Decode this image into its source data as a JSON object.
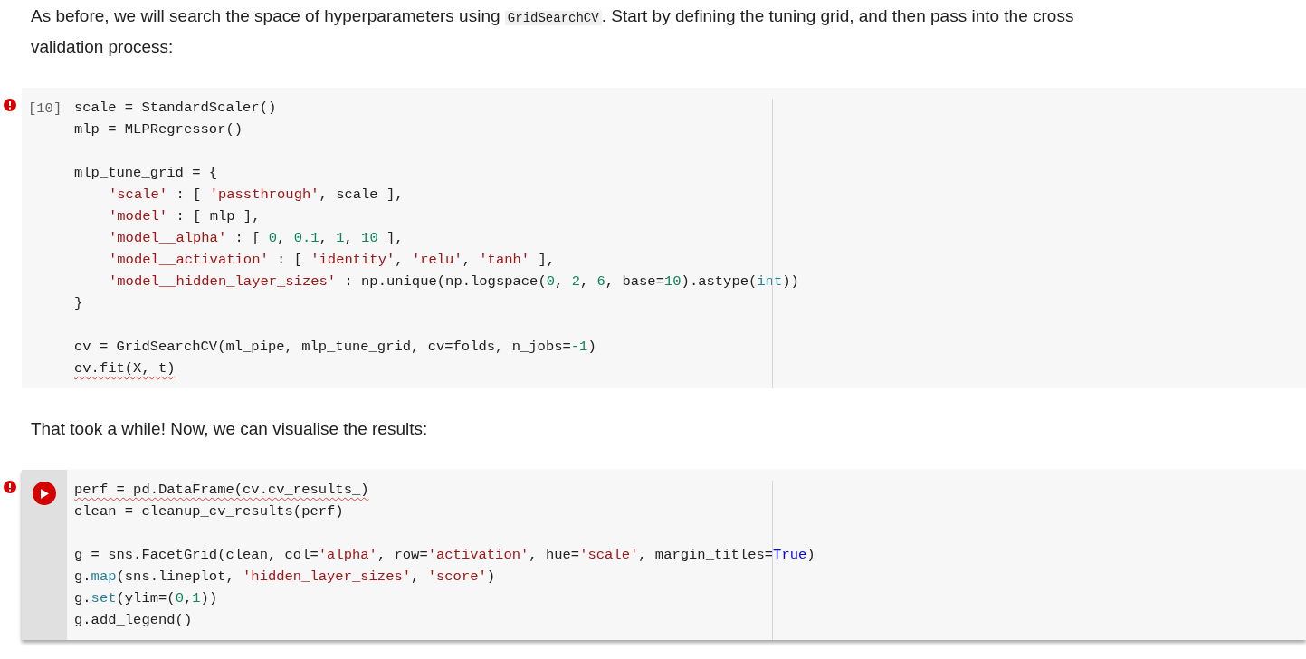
{
  "cells": [
    {
      "kind": "text",
      "parts": [
        {
          "text": "As before, we will search the space of hyperparameters using "
        },
        {
          "text": "GridSearchCV",
          "kind": "code"
        },
        {
          "text": ". Start by defining the tuning grid, and then pass into the cross validation process:"
        }
      ]
    },
    {
      "kind": "code",
      "error": true,
      "active": false,
      "count": "[10]",
      "lines": [
        {
          "segs": [
            {
              "t": "scale = StandardScaler()"
            }
          ]
        },
        {
          "segs": [
            {
              "t": "mlp = MLPRegressor()"
            }
          ]
        },
        {
          "gap_before": true,
          "segs": [
            {
              "t": "mlp_tune_grid = {"
            }
          ]
        },
        {
          "indent": true,
          "segs": [
            {
              "t": "'scale'",
              "kind": "s"
            },
            {
              "t": " : [ "
            },
            {
              "t": "'passthrough'",
              "kind": "s"
            },
            {
              "t": ", scale ],"
            }
          ]
        },
        {
          "indent": true,
          "segs": [
            {
              "t": "'model'",
              "kind": "s"
            },
            {
              "t": " : [ mlp ],"
            }
          ]
        },
        {
          "indent": true,
          "segs": [
            {
              "t": "'model__alpha'",
              "kind": "s"
            },
            {
              "t": " : [ "
            },
            {
              "t": "0",
              "kind": "n"
            },
            {
              "t": ", "
            },
            {
              "t": "0.1",
              "kind": "n"
            },
            {
              "t": ", "
            },
            {
              "t": "1",
              "kind": "n"
            },
            {
              "t": ", "
            },
            {
              "t": "10",
              "kind": "n"
            },
            {
              "t": " ],"
            }
          ]
        },
        {
          "indent": true,
          "segs": [
            {
              "t": "'model__activation'",
              "kind": "s"
            },
            {
              "t": " : [ "
            },
            {
              "t": "'identity'",
              "kind": "s"
            },
            {
              "t": ", "
            },
            {
              "t": "'relu'",
              "kind": "s"
            },
            {
              "t": ", "
            },
            {
              "t": "'tanh'",
              "kind": "s"
            },
            {
              "t": " ],"
            }
          ]
        },
        {
          "indent": true,
          "segs": [
            {
              "t": "'model__hidden_layer_sizes'",
              "kind": "s"
            },
            {
              "t": " : np.unique(np.logspace("
            },
            {
              "t": "0",
              "kind": "n"
            },
            {
              "t": ", "
            },
            {
              "t": "2",
              "kind": "n"
            },
            {
              "t": ", "
            },
            {
              "t": "6",
              "kind": "n"
            },
            {
              "t": ", base="
            },
            {
              "t": "10",
              "kind": "n"
            },
            {
              "t": ").astype("
            },
            {
              "t": "int",
              "kind": "b"
            },
            {
              "t": "))"
            }
          ]
        },
        {
          "segs": [
            {
              "t": "}"
            }
          ]
        },
        {
          "gap_before": true,
          "segs": [
            {
              "t": "cv = GridSearchCV(ml_pipe, mlp_tune_grid, cv=folds, n_jobs="
            },
            {
              "t": "-1",
              "kind": "n"
            },
            {
              "t": ")"
            }
          ]
        },
        {
          "squiggly": true,
          "segs": [
            {
              "t": "cv.fit(X, t)"
            }
          ]
        }
      ]
    },
    {
      "kind": "text",
      "parts": [
        {
          "text": "That took a while! Now, we can visualise the results:"
        }
      ]
    },
    {
      "kind": "code",
      "error": true,
      "active": true,
      "lines": [
        {
          "squiggly": true,
          "segs": [
            {
              "t": "perf = pd.DataFrame(cv.cv_results_)"
            }
          ]
        },
        {
          "segs": [
            {
              "t": "clean = cleanup_cv_results(perf)"
            }
          ]
        },
        {
          "gap_before": true,
          "segs": [
            {
              "t": "g = sns.FacetGrid(clean, col="
            },
            {
              "t": "'alpha'",
              "kind": "s"
            },
            {
              "t": ", row="
            },
            {
              "t": "'activation'",
              "kind": "s"
            },
            {
              "t": ", hue="
            },
            {
              "t": "'scale'",
              "kind": "s"
            },
            {
              "t": ", margin_titles="
            },
            {
              "t": "True",
              "kind": "c"
            },
            {
              "t": ")"
            }
          ]
        },
        {
          "segs": [
            {
              "t": "g."
            },
            {
              "t": "map",
              "kind": "b"
            },
            {
              "t": "(sns.lineplot, "
            },
            {
              "t": "'hidden_layer_sizes'",
              "kind": "s"
            },
            {
              "t": ", "
            },
            {
              "t": "'score'",
              "kind": "s"
            },
            {
              "t": ")"
            }
          ]
        },
        {
          "segs": [
            {
              "t": "g."
            },
            {
              "t": "set",
              "kind": "b"
            },
            {
              "t": "(ylim=("
            },
            {
              "t": "0",
              "kind": "n"
            },
            {
              "t": ","
            },
            {
              "t": "1",
              "kind": "n"
            },
            {
              "t": "))"
            }
          ]
        },
        {
          "segs": [
            {
              "t": "g.add_legend()"
            }
          ]
        }
      ]
    }
  ]
}
